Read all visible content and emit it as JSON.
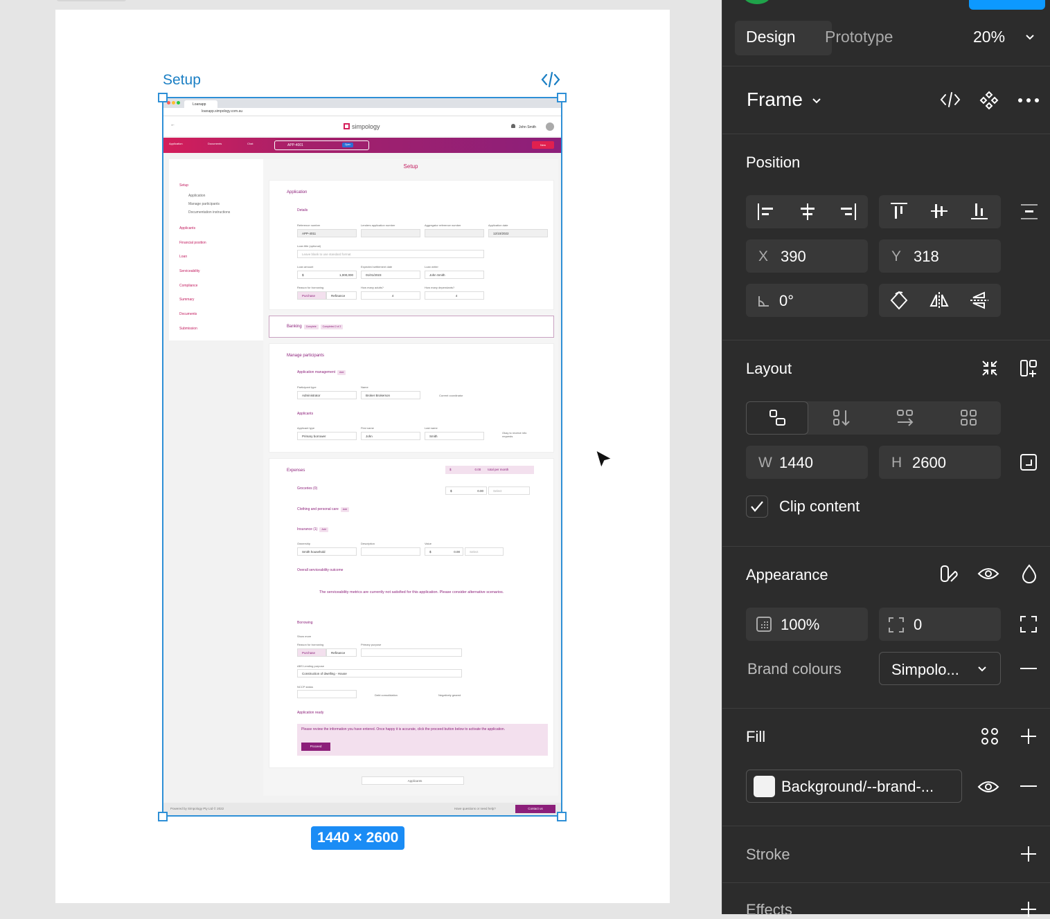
{
  "canvas": {
    "frame_label": "Setup",
    "dimensions": "1440 × 2600",
    "app": {
      "browser_tab": "Loanapp",
      "url": "loanapp.simpology.com.au",
      "logo": "simpology",
      "user": "John Smith",
      "nav": [
        "Application",
        "Documents",
        "Chat"
      ],
      "app_id": "APP-4001",
      "status": "Open",
      "new_button": "New",
      "page_title": "Setup",
      "sidebar": {
        "setup": "Setup",
        "setup_sub": [
          "Application",
          "Manage participants",
          "Documentation instructions"
        ],
        "items": [
          "Applicants",
          "Financial position",
          "Loan",
          "Serviceability",
          "Compliance",
          "Summary",
          "Documents",
          "Submission"
        ]
      },
      "application": {
        "title": "Application",
        "details": "Details",
        "labels": [
          "Reference number",
          "Lenders application number",
          "Aggregator reference number",
          "Application date"
        ],
        "reference": "APP-4011",
        "date": "12/10/2022",
        "loan_title_label": "Loan title (optional)",
        "loan_title_placeholder": "Leave blank to use standard format",
        "loan_amount_label": "Loan amount",
        "loan_amount": "1,000,000",
        "currency": "$",
        "settlement_label": "Expected settlement date",
        "settlement": "01/01/2023",
        "writer_label": "Loan writer",
        "writer": "John Smith",
        "reason_label": "Reason for borrowing",
        "purchase": "Purchase",
        "refinance": "Refinance",
        "adults_label": "How many adults?",
        "adults": "4",
        "dependants_label": "How many dependants?",
        "dependants": "4"
      },
      "banking": {
        "title": "Banking",
        "status": "Complete",
        "completed": "Completed 2 of 2"
      },
      "participants": {
        "title": "Manage participants",
        "mgmt": "Application management",
        "add": "Add",
        "ptype_label": "Participant type",
        "ptype": "Administrator",
        "name_label": "Name",
        "name": "Broker Brokerson",
        "coordinator": "Current coordinator",
        "applicants": "Applicants",
        "atype_label": "Applicant type",
        "atype": "Primary borrower",
        "first_label": "First name",
        "first": "John",
        "last_label": "Last name",
        "last": "Smith",
        "reports": "Okay to receive info requests"
      },
      "expenses": {
        "title": "Expenses",
        "total": "0.00",
        "total_label": "total per month",
        "groceries": "Groceries (0)",
        "groceries_value": "0.00",
        "select": "Select",
        "clothing": "Clothing and personal care",
        "insurance": "Insurance (1)",
        "ownership_label": "Ownership",
        "ownership": "Smith household",
        "description_label": "Description",
        "value_label": "Value",
        "value": "0.00"
      },
      "outcome": {
        "title": "Overall serviceability outcome",
        "message": "The serviceability metrics are currently not satisfied for this application. Please consider alternative scenarios."
      },
      "borrowing": {
        "title": "Borrowing",
        "show_more": "Show more",
        "reason_label": "Reason for borrowing",
        "purpose_label": "Primary purpose",
        "abs_label": "ABS Lending purpose",
        "abs": "Construction of dwelling - House",
        "nccp_label": "NCCP status",
        "debt": "Debt consolidation",
        "geared": "Negatively geared"
      },
      "ready": {
        "title": "Application ready",
        "message": "Please review the information you have entered. Once happy it is accurate, click the proceed button below to activate the application.",
        "proceed": "Proceed"
      },
      "next_button": "Applicants",
      "footer": "Powered by Simpology Pty Ltd © 2022",
      "help": "Have questions or need help?",
      "contact": "Contact us"
    }
  },
  "panel": {
    "tabs": {
      "design": "Design",
      "prototype": "Prototype",
      "zoom": "20%"
    },
    "frame": "Frame",
    "position": {
      "title": "Position",
      "x_label": "X",
      "x": "390",
      "y_label": "Y",
      "y": "318",
      "rotation": "0°"
    },
    "layout": {
      "title": "Layout",
      "w_label": "W",
      "w": "1440",
      "h_label": "H",
      "h": "2600",
      "clip": "Clip content"
    },
    "appearance": {
      "title": "Appearance",
      "opacity": "100%",
      "radius": "0",
      "brand_label": "Brand colours",
      "brand_value": "Simpolo..."
    },
    "fill": {
      "title": "Fill",
      "swatch": "Background/--brand-...",
      "swatch_color": "#f2f2f2"
    },
    "stroke": {
      "title": "Stroke"
    },
    "effects": {
      "title": "Effects"
    }
  }
}
